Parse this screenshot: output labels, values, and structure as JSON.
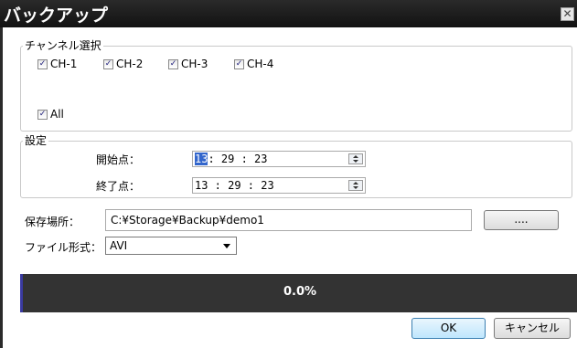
{
  "window": {
    "title": "バックアップ",
    "close_glyph": "✕"
  },
  "channels": {
    "legend": "チャンネル選択",
    "items": [
      {
        "label": "CH-1",
        "checked": true
      },
      {
        "label": "CH-2",
        "checked": true
      },
      {
        "label": "CH-3",
        "checked": true
      },
      {
        "label": "CH-4",
        "checked": true
      }
    ],
    "all": {
      "label": "All",
      "checked": true
    },
    "check_glyph": "✓"
  },
  "settings": {
    "legend": "設定",
    "start_label": "開始点：",
    "start_time": {
      "hh": "13",
      "rest": ": 29 : 23"
    },
    "end_label": "終了点：",
    "end_time": "13 : 29 : 23"
  },
  "save_location": {
    "label": "保存場所：",
    "value": "C:¥Storage¥Backup¥demo1",
    "browse_label": "...."
  },
  "file_format": {
    "label": "ファイル形式：",
    "selected": "AVI"
  },
  "progress": {
    "value": 0.0,
    "text": "0.0%"
  },
  "buttons": {
    "ok": "OK",
    "cancel": "キャンセル"
  },
  "colors": {
    "progress_bg": "#333333",
    "progress_accent": "#3a3aa0",
    "titlebar": "#1a1a1a"
  }
}
